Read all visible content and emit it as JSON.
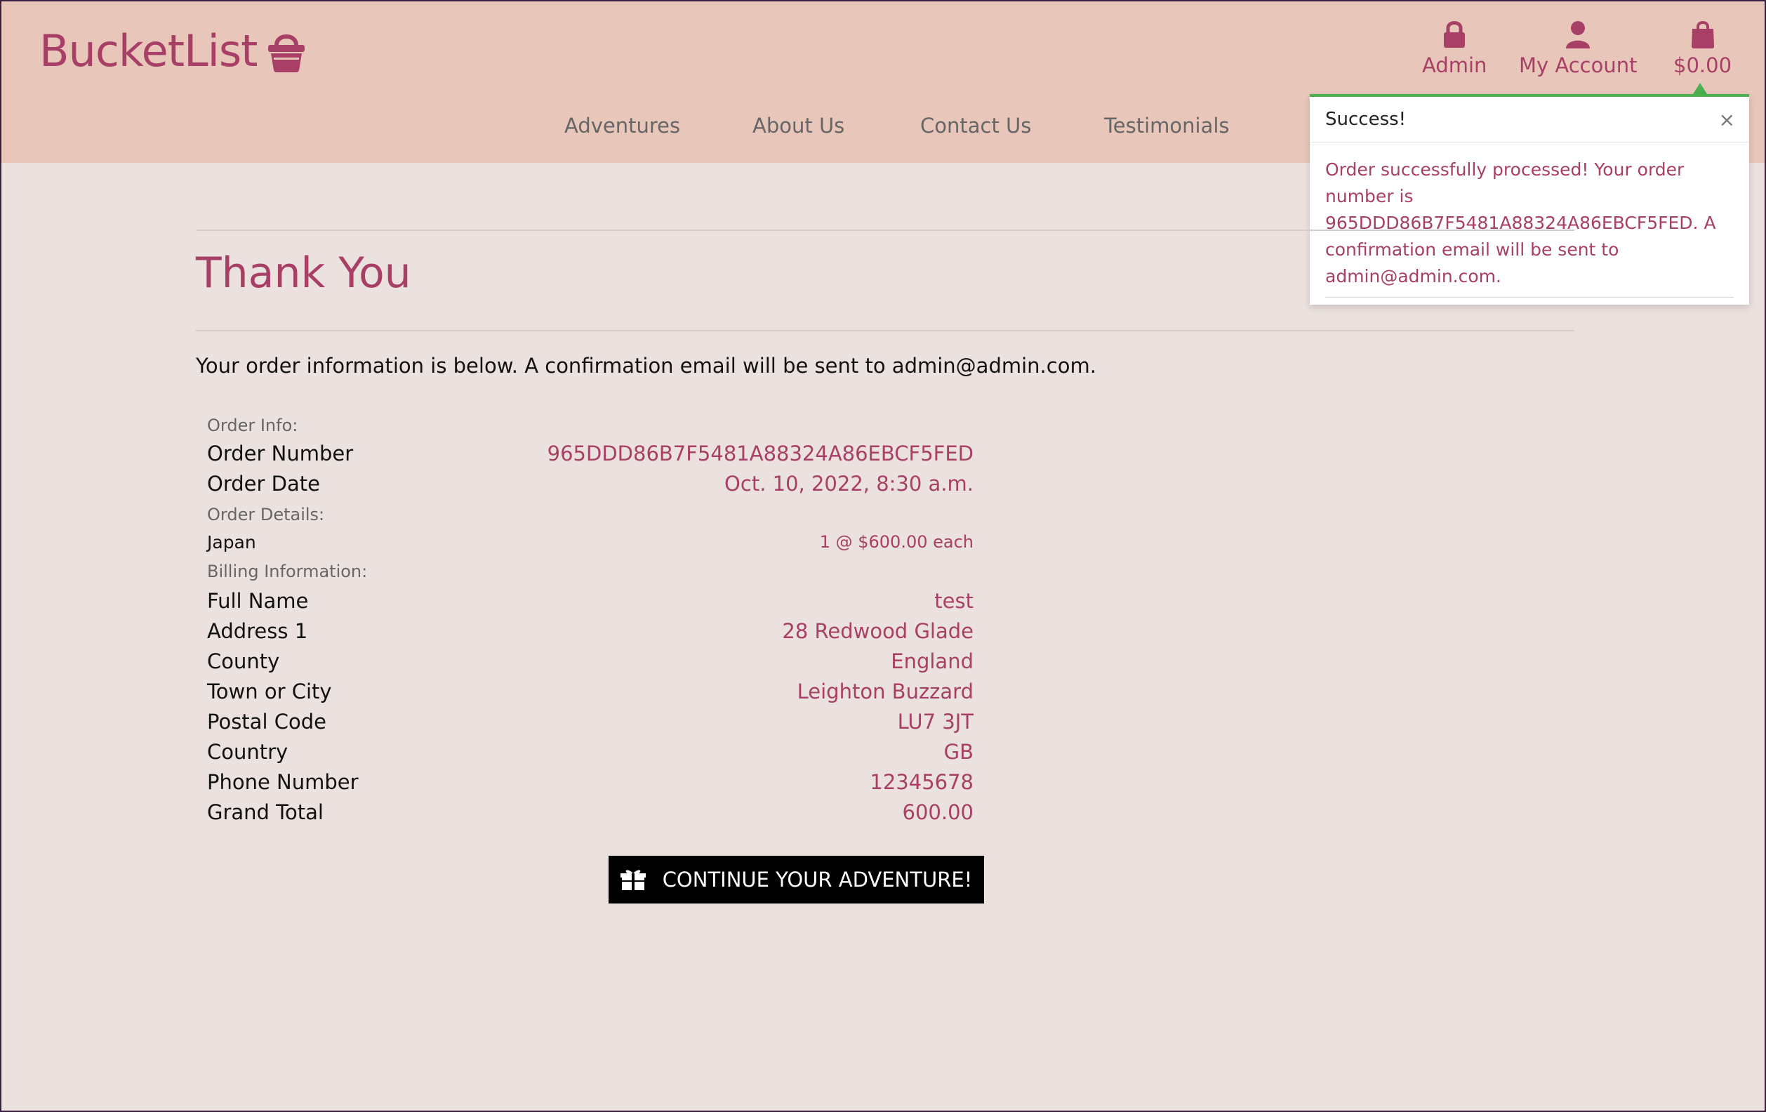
{
  "brand": {
    "name": "BucketList",
    "icon": "basket-icon"
  },
  "top_nav": {
    "admin": {
      "label": "Admin",
      "icon": "lock-icon"
    },
    "account": {
      "label": "My Account",
      "icon": "user-icon"
    },
    "bag": {
      "label": "$0.00",
      "icon": "shopping-bag-icon"
    }
  },
  "nav": {
    "items": [
      {
        "label": "Adventures"
      },
      {
        "label": "About Us"
      },
      {
        "label": "Contact Us"
      },
      {
        "label": "Testimonials"
      }
    ]
  },
  "toast": {
    "title": "Success!",
    "close": "×",
    "message": "Order successfully processed! Your order number is 965DDD86B7F5481A88324A86EBCF5FED. A confirmation email will be sent to admin@admin.com."
  },
  "page": {
    "title": "Thank You",
    "lead": "Your order information is below. A confirmation email will be sent to admin@admin.com."
  },
  "order": {
    "order_info_label": "Order Info:",
    "order_number_label": "Order Number",
    "order_number": "965DDD86B7F5481A88324A86EBCF5FED",
    "order_date_label": "Order Date",
    "order_date": "Oct. 10, 2022, 8:30 a.m.",
    "order_details_label": "Order Details:",
    "item_name": "Japan",
    "item_qty": "1 @ $600.00 each",
    "billing_label": "Billing Information:",
    "billing": [
      {
        "key": "Full Name",
        "value": "test"
      },
      {
        "key": "Address 1",
        "value": "28 Redwood Glade"
      },
      {
        "key": "County",
        "value": "England"
      },
      {
        "key": "Town or City",
        "value": "Leighton Buzzard"
      },
      {
        "key": "Postal Code",
        "value": "LU7 3JT"
      },
      {
        "key": "Country",
        "value": "GB"
      },
      {
        "key": "Phone Number",
        "value": "12345678"
      },
      {
        "key": "Grand Total",
        "value": "600.00"
      }
    ]
  },
  "cta": {
    "label": "CONTINUE YOUR ADVENTURE!",
    "icon": "gift-icon"
  },
  "colors": {
    "accent": "#a83f66",
    "header": "#e8c7ba",
    "background": "#ebe1de",
    "toast_border": "#4caf50"
  }
}
